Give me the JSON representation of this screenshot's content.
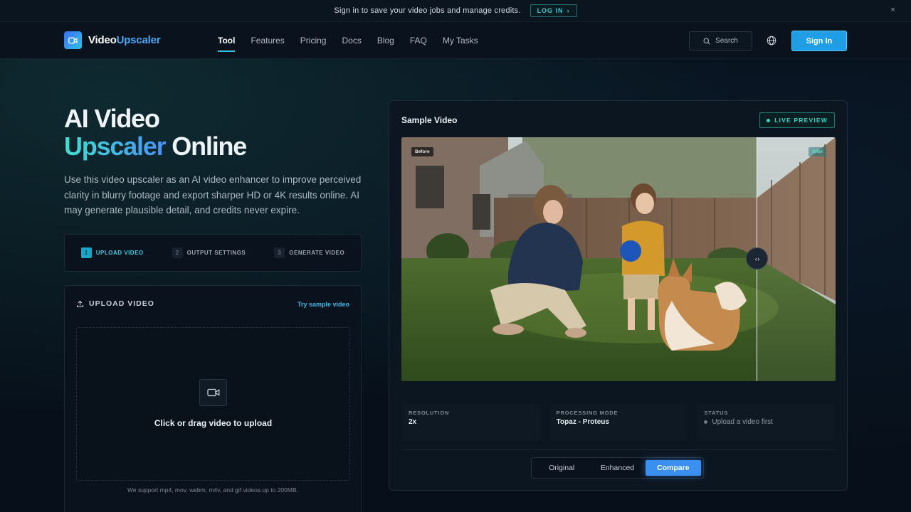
{
  "banner": {
    "message": "Sign in to save your video jobs and manage credits.",
    "login_label": "LOG IN",
    "close_label": "×"
  },
  "nav": {
    "logo_main": "Video",
    "logo_accent": "Upscaler",
    "items": [
      "Tool",
      "Features",
      "Pricing",
      "Docs",
      "Blog",
      "FAQ",
      "My Tasks"
    ],
    "active_item": "Tool",
    "search_label": "Search",
    "signin_label": "Sign In"
  },
  "hero": {
    "title_line1": "AI Video",
    "title_accent": "Upscaler",
    "title_rest": " Online",
    "description": "Use this video upscaler as an AI video enhancer to improve perceived clarity in blurry footage and export sharper HD or 4K results online. AI may generate plausible detail, and credits never expire."
  },
  "steps": [
    {
      "num": "1",
      "label": "UPLOAD VIDEO",
      "active": true
    },
    {
      "num": "2",
      "label": "OUTPUT SETTINGS",
      "active": false
    },
    {
      "num": "3",
      "label": "GENERATE VIDEO",
      "active": false
    }
  ],
  "upload": {
    "heading": "UPLOAD VIDEO",
    "try_sample": "Try sample video",
    "dropzone_text": "Click or drag video to upload",
    "support_text": "We support mp4, mov, webm, m4v, and gif videos up to 200MB."
  },
  "preview": {
    "title": "Sample Video",
    "live_badge": "LIVE PREVIEW",
    "before_tag": "Before",
    "after_tag": "After",
    "handle_glyph": "‹ ›",
    "stats": {
      "resolution_label": "RESOLUTION",
      "resolution_value": "2x",
      "mode_label": "PROCESSING MODE",
      "mode_value": "Topaz - Proteus",
      "status_label": "STATUS",
      "status_value": "Upload a video first"
    },
    "views": [
      "Original",
      "Enhanced",
      "Compare"
    ],
    "selected_view": "Compare"
  },
  "colors": {
    "accent_cyan": "#2dc4e6",
    "primary_blue": "#1f9ee6",
    "compare_blue": "#3b8ff0",
    "live_green": "#33d6c1"
  }
}
